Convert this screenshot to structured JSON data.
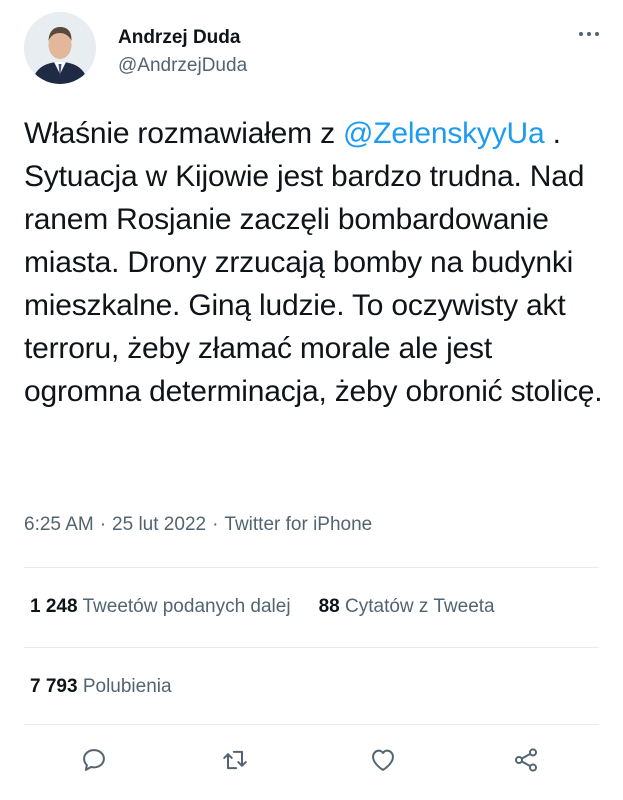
{
  "author": {
    "name": "Andrzej Duda",
    "handle": "@AndrzejDuda",
    "more_icon": "more-horizontal-icon"
  },
  "tweet": {
    "text_before": "Właśnie rozmawiałem z ",
    "mention": "@ZelenskyyUa",
    "text_after": " . Sytuacja w Kijowie jest bardzo trudna. Nad ranem Rosjanie zaczęli bombardowanie miasta. Drony zrzucają bomby na budynki mieszkalne. Giną ludzie. To oczywisty akt terroru, żeby złamać morale ale jest ogromna determinacja, żeby obronić stolicę."
  },
  "meta": {
    "time": "6:25 AM",
    "separator": "·",
    "date": "25 lut 2022",
    "source": "Twitter for iPhone"
  },
  "stats": {
    "retweets_count": "1 248",
    "retweets_label": "Tweetów podanych dalej",
    "quotes_count": "88",
    "quotes_label": "Cytatów z Tweeta",
    "likes_count": "7 793",
    "likes_label": "Polubienia"
  },
  "actions": [
    "reply-icon",
    "retweet-icon",
    "heart-icon",
    "share-icon"
  ],
  "colors": {
    "text": "#0f1419",
    "secondary": "#536471",
    "link": "#1d9bf0",
    "divider": "#e7ebee"
  }
}
